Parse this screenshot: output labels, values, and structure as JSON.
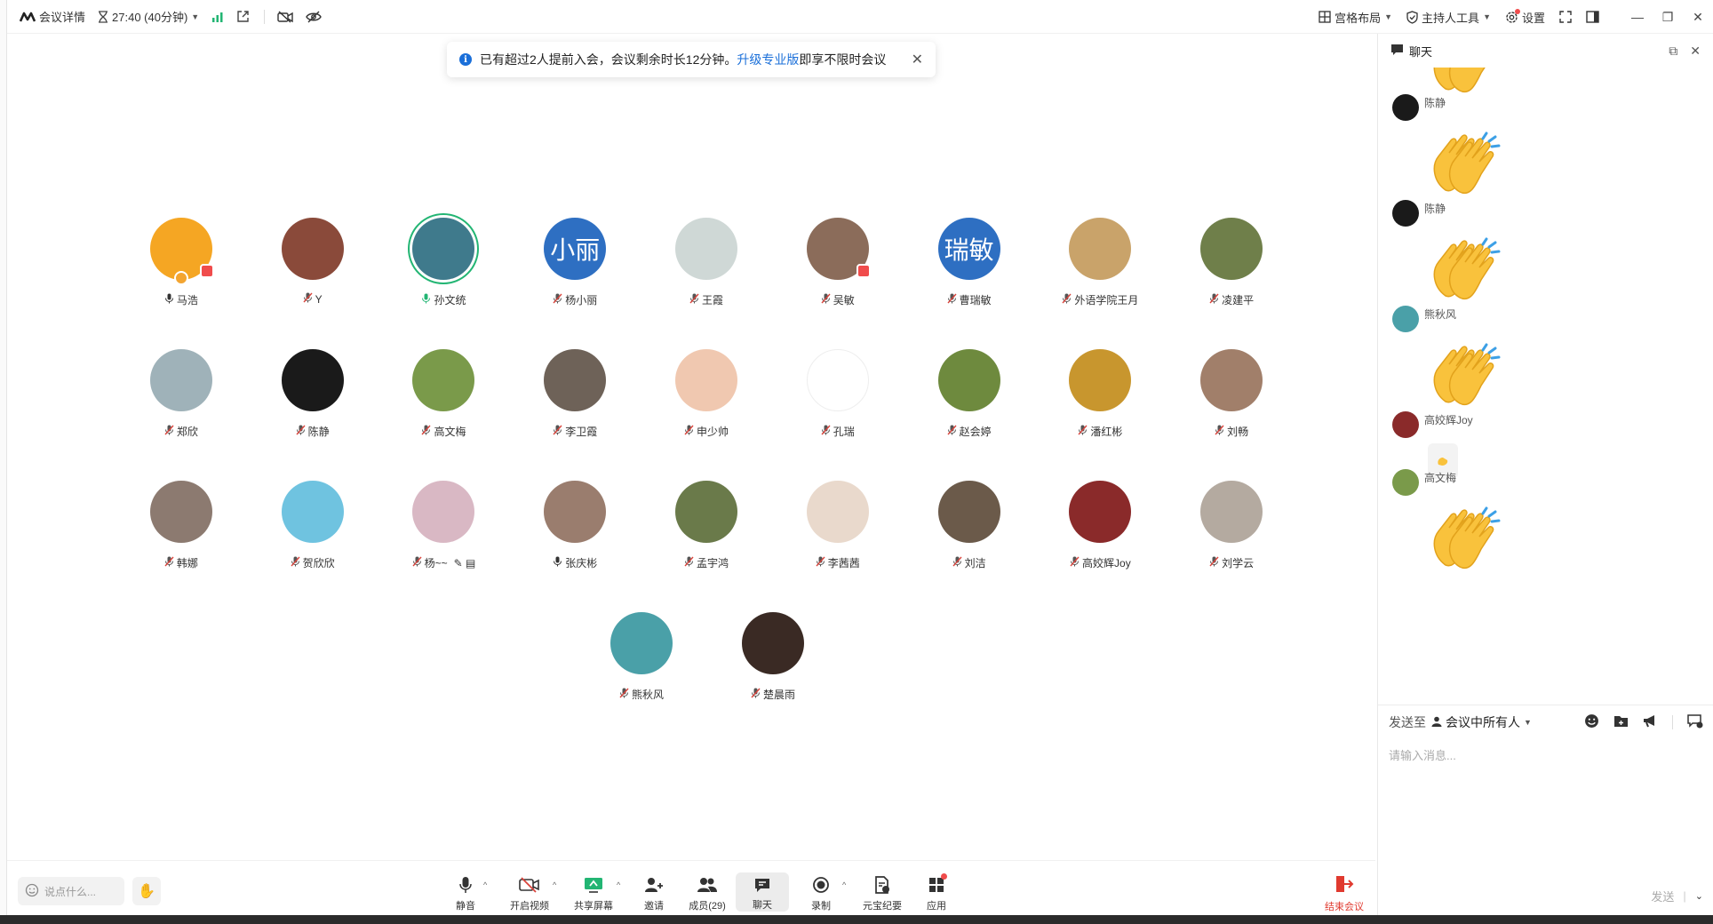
{
  "topbar": {
    "meeting_details": "会议详情",
    "timer": "27:40 (40分钟)",
    "layout": "宫格布局",
    "host_tools": "主持人工具",
    "settings": "设置"
  },
  "notice": {
    "text_before": "已有超过2人提前入会，会议剩余时长12分钟。",
    "link": "升级专业版",
    "text_after": "即享不限时会议"
  },
  "participants": [
    {
      "name": "马浩",
      "mic": "unmuted",
      "avatar_color": "#f5a623",
      "badge": true,
      "host_badge": true
    },
    {
      "name": "Y",
      "mic": "muted",
      "avatar_color": "#8a4a3a"
    },
    {
      "name": "孙文统",
      "mic": "speaking",
      "avatar_color": "#3f7a8c",
      "speaking": true
    },
    {
      "name": "杨小丽",
      "mic": "muted",
      "avatar_text": "小丽",
      "avatar_color": "#2e6fc2"
    },
    {
      "name": "王霞",
      "mic": "muted",
      "avatar_color": "#cfd8d6"
    },
    {
      "name": "吴敏",
      "mic": "muted",
      "avatar_color": "#8b6c5a",
      "badge": true
    },
    {
      "name": "曹瑞敏",
      "mic": "muted",
      "avatar_text": "瑞敏",
      "avatar_color": "#2e6fc2"
    },
    {
      "name": "外语学院王月",
      "mic": "muted",
      "avatar_color": "#c9a36a"
    },
    {
      "name": "凌建平",
      "mic": "muted",
      "avatar_color": "#6f7f4a"
    },
    {
      "name": "郑欣",
      "mic": "muted",
      "avatar_color": "#9fb2b9"
    },
    {
      "name": "陈静",
      "mic": "muted",
      "avatar_color": "#1a1a1a"
    },
    {
      "name": "高文梅",
      "mic": "muted",
      "avatar_color": "#7a9a4a"
    },
    {
      "name": "李卫霞",
      "mic": "muted",
      "avatar_color": "#6e6258"
    },
    {
      "name": "申少帅",
      "mic": "muted",
      "avatar_color": "#f0c8b0"
    },
    {
      "name": "孔瑞",
      "mic": "muted",
      "avatar_color": "#ffffff"
    },
    {
      "name": "赵会婷",
      "mic": "muted",
      "avatar_color": "#6e8a3e"
    },
    {
      "name": "潘红彬",
      "mic": "muted",
      "avatar_color": "#c8962e"
    },
    {
      "name": "刘畅",
      "mic": "muted",
      "avatar_color": "#a17f6a"
    },
    {
      "name": "韩娜",
      "mic": "muted",
      "avatar_color": "#8c7a70"
    },
    {
      "name": "贺欣欣",
      "mic": "muted",
      "avatar_color": "#6fc3e0"
    },
    {
      "name": "杨~~",
      "mic": "muted",
      "avatar_color": "#d9b8c4",
      "extra": "✎ ▤"
    },
    {
      "name": "张庆彬",
      "mic": "unmuted",
      "avatar_color": "#9a7d6e"
    },
    {
      "name": "孟宇鸿",
      "mic": "muted",
      "avatar_color": "#6a7a4a"
    },
    {
      "name": "李茜茜",
      "mic": "muted",
      "avatar_color": "#e9d9cc"
    },
    {
      "name": "刘洁",
      "mic": "muted",
      "avatar_color": "#6b5a4a"
    },
    {
      "name": "高姣辉Joy",
      "mic": "muted",
      "avatar_color": "#8a2a2a"
    },
    {
      "name": "刘学云",
      "mic": "muted",
      "avatar_color": "#b4aaa0"
    },
    {
      "name": "熊秋风",
      "mic": "muted",
      "avatar_color": "#4aa0a8"
    },
    {
      "name": "楚晨雨",
      "mic": "muted",
      "avatar_color": "#3a2a24"
    }
  ],
  "toolbar": {
    "say_placeholder": "说点什么...",
    "mute": "静音",
    "video": "开启视频",
    "share": "共享屏幕",
    "invite": "邀请",
    "members": "成员(29)",
    "chat": "聊天",
    "record": "录制",
    "ai_minutes": "元宝纪要",
    "apps": "应用",
    "end": "结束会议"
  },
  "chat": {
    "title": "聊天",
    "messages": [
      {
        "sender": "陈静",
        "type": "clap"
      },
      {
        "sender": "陈静",
        "type": "clap"
      },
      {
        "sender": "熊秋风",
        "type": "clap"
      },
      {
        "sender": "高姣辉Joy",
        "type": "small"
      },
      {
        "sender": "高文梅",
        "type": "clap"
      }
    ],
    "send_to_label": "发送至",
    "send_target": "会议中所有人",
    "input_placeholder": "请输入消息...",
    "send_button": "发送"
  },
  "colors": {
    "accent": "#1a6fd9",
    "muted_mic": "#d8433b",
    "speaking": "#22b573",
    "end_meeting": "#e03a2f",
    "clap_yellow": "#f9c23c"
  }
}
